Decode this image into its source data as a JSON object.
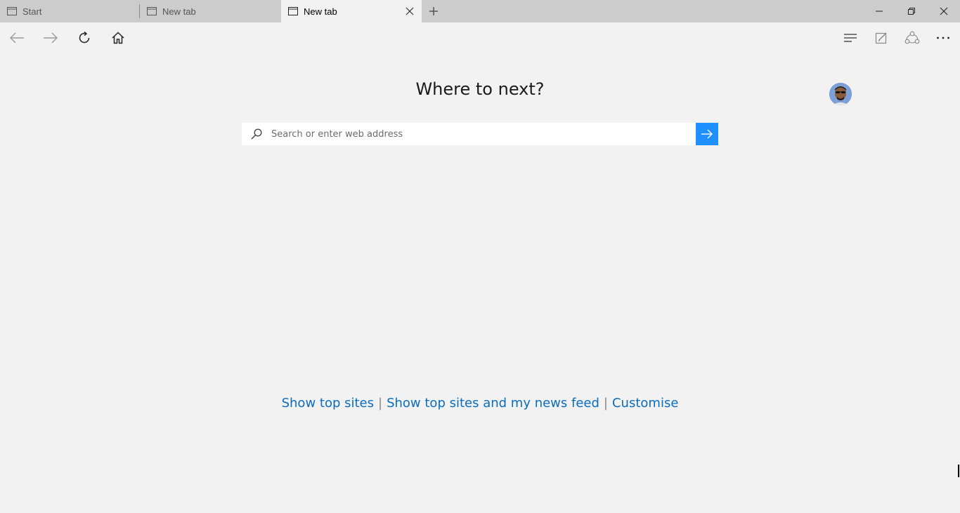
{
  "tabs": [
    {
      "label": "Start",
      "active": false
    },
    {
      "label": "New tab",
      "active": false
    },
    {
      "label": "New tab",
      "active": true
    }
  ],
  "icons": {
    "back": "arrow-left-icon",
    "forward": "arrow-right-icon",
    "refresh": "refresh-icon",
    "home": "home-icon",
    "hub": "hub-icon",
    "notes": "web-note-icon",
    "share": "share-icon",
    "more": "more-icon"
  },
  "main": {
    "heading": "Where to next?",
    "search_placeholder": "Search or enter web address"
  },
  "links": {
    "top_sites": "Show top sites",
    "separator": "|",
    "top_sites_news": "Show top sites and my news feed",
    "customise": "Customise"
  },
  "colors": {
    "accent": "#1e90ff",
    "link": "#0a6dbd",
    "background": "#f2f2f2",
    "tabstrip": "#cccccc"
  }
}
